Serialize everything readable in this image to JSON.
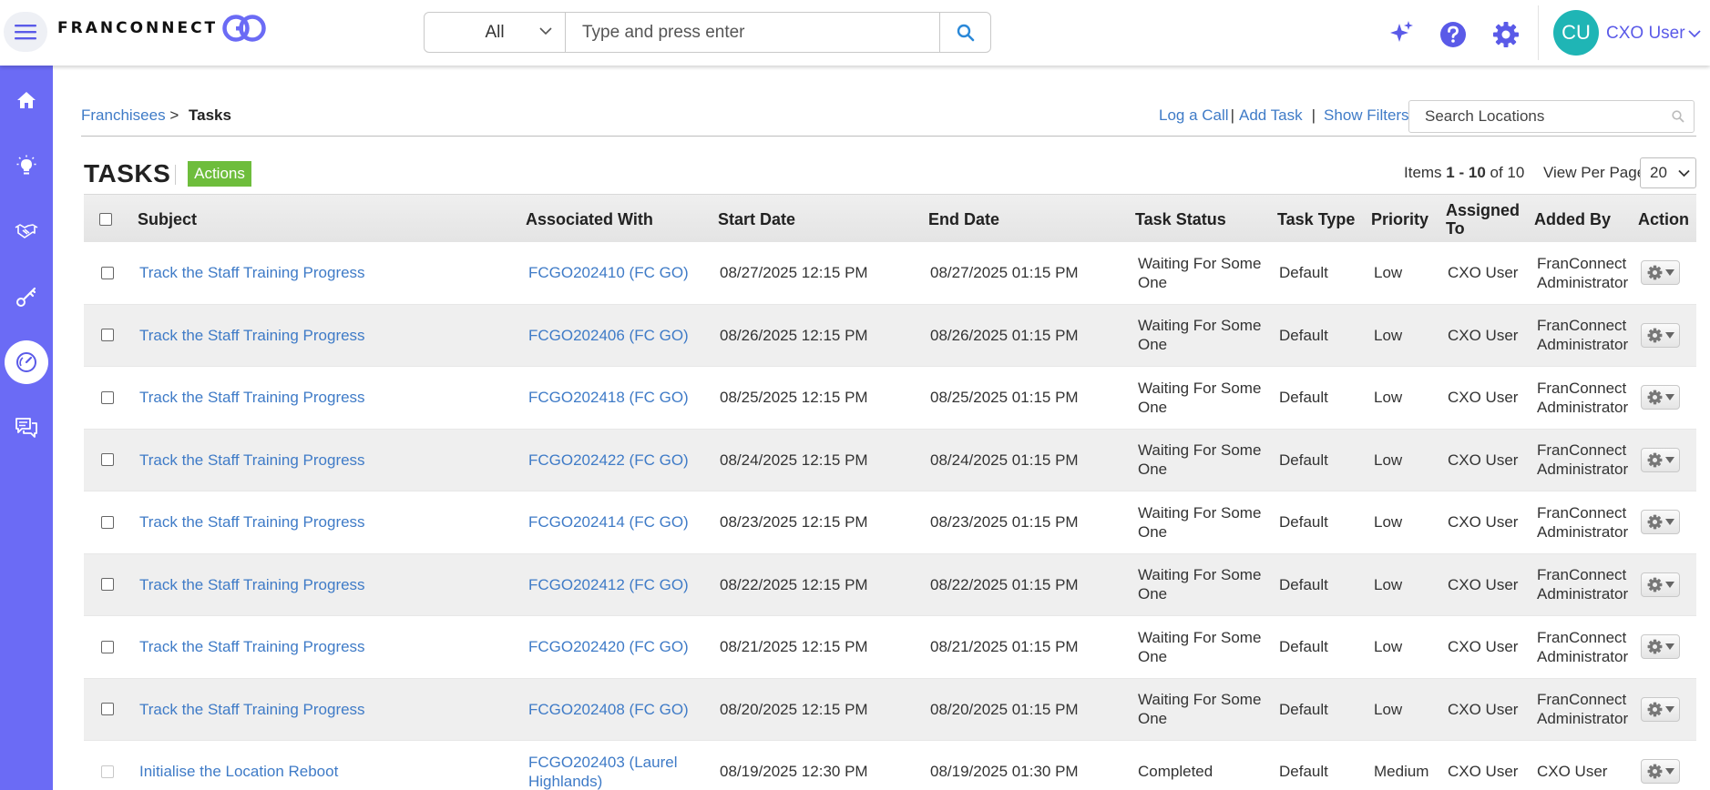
{
  "header": {
    "logo_text": "FRANCONNECT",
    "search_scope": "All",
    "search_placeholder": "Type and press enter",
    "user_initials": "CU",
    "user_name": "CXO User"
  },
  "sidebar": {
    "items": [
      {
        "icon": "home-icon"
      },
      {
        "icon": "lightbulb-icon"
      },
      {
        "icon": "handshake-icon"
      },
      {
        "icon": "key-icon"
      },
      {
        "icon": "gauge-icon",
        "active": true
      },
      {
        "icon": "chat-icon"
      }
    ]
  },
  "breadcrumb": {
    "parent": "Franchisees",
    "separator": ">",
    "current": "Tasks"
  },
  "links": {
    "log_call": "Log a Call",
    "add_task": "Add Task",
    "show_filters": "Show Filters",
    "sep": "|",
    "search_placeholder": "Search Locations"
  },
  "page": {
    "title": "TASKS",
    "actions_label": "Actions",
    "items_prefix": "Items",
    "items_range": "1 - 10",
    "items_of": "of 10",
    "view_per_page_label": "View Per Page",
    "view_per_page_value": "20"
  },
  "table": {
    "columns": [
      "Subject",
      "Associated With",
      "Start Date",
      "End Date",
      "Task Status",
      "Task Type",
      "Priority",
      "Assigned To",
      "Added By",
      "Action"
    ],
    "rows": [
      {
        "subject": "Track the Staff Training Progress",
        "assoc1": "FCGO202410 (FC GO)",
        "assoc2": "",
        "start": "08/27/2025 12:15 PM",
        "end": "08/27/2025 01:15 PM",
        "status1": "Waiting For Some",
        "status2": "One",
        "type": "Default",
        "priority": "Low",
        "assigned": "CXO User",
        "added1": "FranConnect",
        "added2": "Administrator"
      },
      {
        "subject": "Track the Staff Training Progress",
        "assoc1": "FCGO202406 (FC GO)",
        "assoc2": "",
        "start": "08/26/2025 12:15 PM",
        "end": "08/26/2025 01:15 PM",
        "status1": "Waiting For Some",
        "status2": "One",
        "type": "Default",
        "priority": "Low",
        "assigned": "CXO User",
        "added1": "FranConnect",
        "added2": "Administrator"
      },
      {
        "subject": "Track the Staff Training Progress",
        "assoc1": "FCGO202418 (FC GO)",
        "assoc2": "",
        "start": "08/25/2025 12:15 PM",
        "end": "08/25/2025 01:15 PM",
        "status1": "Waiting For Some",
        "status2": "One",
        "type": "Default",
        "priority": "Low",
        "assigned": "CXO User",
        "added1": "FranConnect",
        "added2": "Administrator"
      },
      {
        "subject": "Track the Staff Training Progress",
        "assoc1": "FCGO202422 (FC GO)",
        "assoc2": "",
        "start": "08/24/2025 12:15 PM",
        "end": "08/24/2025 01:15 PM",
        "status1": "Waiting For Some",
        "status2": "One",
        "type": "Default",
        "priority": "Low",
        "assigned": "CXO User",
        "added1": "FranConnect",
        "added2": "Administrator"
      },
      {
        "subject": "Track the Staff Training Progress",
        "assoc1": "FCGO202414 (FC GO)",
        "assoc2": "",
        "start": "08/23/2025 12:15 PM",
        "end": "08/23/2025 01:15 PM",
        "status1": "Waiting For Some",
        "status2": "One",
        "type": "Default",
        "priority": "Low",
        "assigned": "CXO User",
        "added1": "FranConnect",
        "added2": "Administrator"
      },
      {
        "subject": "Track the Staff Training Progress",
        "assoc1": "FCGO202412 (FC GO)",
        "assoc2": "",
        "start": "08/22/2025 12:15 PM",
        "end": "08/22/2025 01:15 PM",
        "status1": "Waiting For Some",
        "status2": "One",
        "type": "Default",
        "priority": "Low",
        "assigned": "CXO User",
        "added1": "FranConnect",
        "added2": "Administrator"
      },
      {
        "subject": "Track the Staff Training Progress",
        "assoc1": "FCGO202420 (FC GO)",
        "assoc2": "",
        "start": "08/21/2025 12:15 PM",
        "end": "08/21/2025 01:15 PM",
        "status1": "Waiting For Some",
        "status2": "One",
        "type": "Default",
        "priority": "Low",
        "assigned": "CXO User",
        "added1": "FranConnect",
        "added2": "Administrator"
      },
      {
        "subject": "Track the Staff Training Progress",
        "assoc1": "FCGO202408 (FC GO)",
        "assoc2": "",
        "start": "08/20/2025 12:15 PM",
        "end": "08/20/2025 01:15 PM",
        "status1": "Waiting For Some",
        "status2": "One",
        "type": "Default",
        "priority": "Low",
        "assigned": "CXO User",
        "added1": "FranConnect",
        "added2": "Administrator"
      },
      {
        "subject": "Initialise the Location Reboot",
        "assoc1": "FCGO202403 (Laurel",
        "assoc2": "Highlands)",
        "start": "08/19/2025 12:30 PM",
        "end": "08/19/2025 01:30 PM",
        "status1": "Completed",
        "status2": "",
        "type": "Default",
        "priority": "Medium",
        "assigned": "CXO User",
        "added1": "CXO User",
        "added2": "",
        "disabled": true
      }
    ]
  },
  "colors": {
    "sidebar": "#6b6bf5",
    "accent": "#5a5ae8",
    "link": "#3f7bc7",
    "actions_button": "#6ebd3c",
    "avatar": "#1fb5b5"
  }
}
